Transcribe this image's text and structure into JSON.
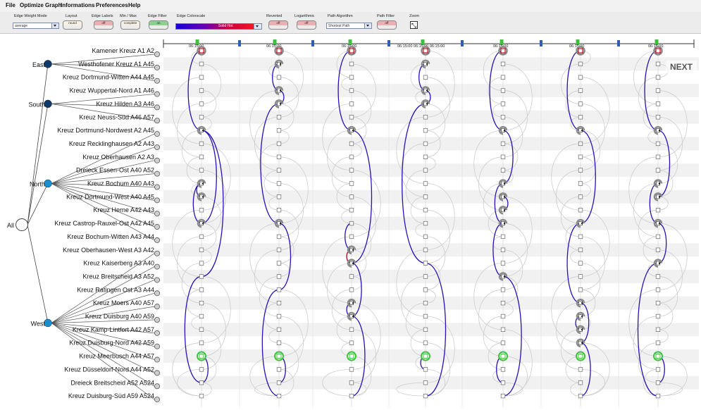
{
  "menu": [
    "File",
    "Optimize Graph",
    "Informations",
    "Preferences",
    "Help"
  ],
  "toolbar": {
    "edge_weight_mode_label": "Edge Weight Mode",
    "edge_weight_mode_value": "average",
    "layout_label": "Layout",
    "layout_value": "round",
    "edge_labels_label": "Edge Labels",
    "edge_labels_value": "off",
    "min_max_label": "Min / Max",
    "min_max_value": "complete",
    "edge_filter_label": "Edge Filter",
    "edge_filter_value": "on",
    "edge_colorscale_label": "Edge Colorscale",
    "edge_colorscale_value": "Solid Hot",
    "reverted_label": "Reverted",
    "reverted_value": "off",
    "logarithmic_label": "Logarithmic",
    "logarithmic_value": "off",
    "path_algorithm_label": "Path Algorithm",
    "path_algorithm_value": "Shortest Path",
    "path_filter_label": "Path Filter",
    "path_filter_value": "off",
    "zoom_label": "Zoom"
  },
  "next_label": "NEXT",
  "tree": {
    "root": "All",
    "groups": [
      {
        "name": "East",
        "color": "#0d3a6b",
        "first_row": 0,
        "last_row": 2
      },
      {
        "name": "South",
        "color": "#0d3a6b",
        "first_row": 3,
        "last_row": 5
      },
      {
        "name": "North",
        "color": "#1a8fd0",
        "first_row": 6,
        "last_row": 14
      },
      {
        "name": "West",
        "color": "#1a8fd0",
        "first_row": 15,
        "last_row": 26
      }
    ]
  },
  "rows": [
    "Kamener Kreuz A1 A2",
    "Westhofener Kreuz A1 A45",
    "Kreuz Dortmund-Witten A44 A45",
    "Kreuz Wuppertal-Nord A1 A46",
    "Kreuz Hilden A3 A46",
    "Kreuz Neuss-Süd A46 A57",
    "Kreuz Dortmund-Nordwest A2 A45",
    "Kreuz Recklinghausen A2 A43",
    "Kreuz Oberhausen A2 A3",
    "Dreieck Essen-Ost A40 A52",
    "Kreuz Bochum A40 A43",
    "Kreuz Dortmund-West A40 A45",
    "Kreuz Herne A42 A43",
    "Kreuz Castrop-Rauxel-Ost A42 A45",
    "Kreuz Bochum-Witten A43 A44",
    "Kreuz Oberhausen-West A3 A42",
    "Kreuz Kaiserberg A3 A40",
    "Kreuz Breitscheid A3 A52",
    "Kreuz Ratingen Ost A3 A44",
    "Kreuz Moers A40 A57",
    "Kreuz Duisburg A40 A59",
    "Kreuz Kamp-Lintfort A42 A57",
    "Kreuz Duisburg-Nord A42 A59",
    "Kreuz Meerbusch A44 A57",
    "Kreuz Düsseldorf-Nord A44 A52",
    "Dreieck Breitscheid A52 A524",
    "Kreuz Duisburg-Süd A59 A524"
  ],
  "timeline": {
    "ticks": [
      "06:15:00",
      "06:15:00",
      "06:15:00",
      "06:15:00 06:15:00 06:15:00",
      "06:15:00",
      "06:15:00",
      "06:15:00"
    ]
  },
  "columns": [
    {
      "red": [
        0
      ],
      "active": [
        6,
        10,
        11,
        13
      ],
      "green": [
        23
      ],
      "arcs": [
        [
          0,
          6
        ],
        [
          6,
          13
        ],
        [
          10,
          13
        ],
        [
          6,
          17
        ],
        [
          17,
          25
        ],
        [
          23,
          25
        ],
        [
          10,
          11
        ]
      ]
    },
    {
      "red": [
        0
      ],
      "active": [
        1,
        3,
        4,
        13
      ],
      "green": [
        23
      ],
      "arcs": [
        [
          1,
          3
        ],
        [
          3,
          4
        ],
        [
          4,
          13
        ],
        [
          13,
          18
        ],
        [
          18,
          26
        ],
        [
          23,
          25
        ]
      ]
    },
    {
      "red": [
        0
      ],
      "active": [
        6,
        15,
        16,
        19,
        20
      ],
      "green": [
        23
      ],
      "arcs": [
        [
          0,
          6
        ],
        [
          6,
          16
        ],
        [
          15,
          16
        ],
        [
          16,
          20
        ],
        [
          19,
          20
        ],
        [
          20,
          26
        ],
        [
          13,
          15
        ]
      ]
    },
    {
      "red": [
        0
      ],
      "active": [
        1,
        3,
        4
      ],
      "green": [
        23
      ],
      "arcs": [
        [
          1,
          3
        ],
        [
          3,
          4
        ],
        [
          4,
          16
        ],
        [
          16,
          26
        ],
        [
          23,
          24
        ]
      ]
    },
    {
      "red": [
        0
      ],
      "active": [
        6,
        10,
        11,
        12,
        13,
        17
      ],
      "green": [
        23
      ],
      "arcs": [
        [
          0,
          6
        ],
        [
          6,
          10
        ],
        [
          10,
          13
        ],
        [
          11,
          12
        ],
        [
          13,
          17
        ],
        [
          17,
          26
        ],
        [
          23,
          25
        ]
      ]
    },
    {
      "red": [
        0
      ],
      "active": [
        6,
        13,
        19,
        20,
        21,
        22
      ],
      "green": [
        23
      ],
      "arcs": [
        [
          0,
          6
        ],
        [
          6,
          13
        ],
        [
          13,
          19
        ],
        [
          19,
          22
        ],
        [
          20,
          21
        ],
        [
          22,
          26
        ]
      ]
    },
    {
      "red": [
        0
      ],
      "active": [
        6,
        10,
        11,
        13,
        16
      ],
      "green": [
        23
      ],
      "arcs": [
        [
          0,
          6
        ],
        [
          6,
          11
        ],
        [
          10,
          13
        ],
        [
          13,
          16
        ],
        [
          16,
          26
        ],
        [
          23,
          25
        ]
      ]
    }
  ]
}
